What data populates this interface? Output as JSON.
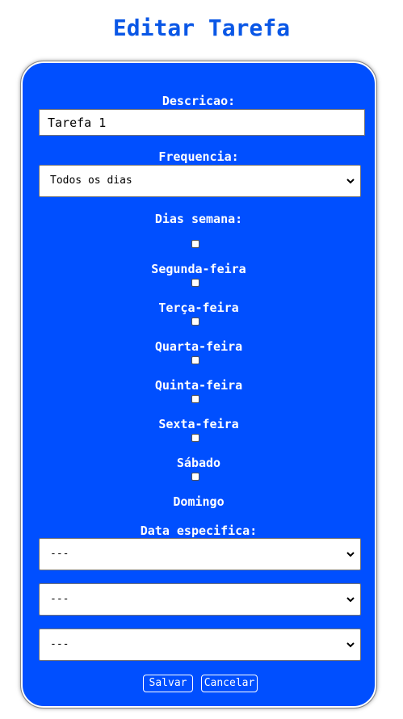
{
  "page": {
    "title": "Editar Tarefa"
  },
  "form": {
    "descricao_label": "Descricao:",
    "descricao_value": "Tarefa 1",
    "frequencia_label": "Frequencia:",
    "frequencia_value": "Todos os dias",
    "dias_semana_label": "Dias semana:",
    "dias": [
      {
        "label": "Segunda-feira",
        "checked": false
      },
      {
        "label": "Terça-feira",
        "checked": false
      },
      {
        "label": "Quarta-feira",
        "checked": false
      },
      {
        "label": "Quinta-feira",
        "checked": false
      },
      {
        "label": "Sexta-feira",
        "checked": false
      },
      {
        "label": "Sábado",
        "checked": false
      },
      {
        "label": "Domingo",
        "checked": false
      }
    ],
    "data_especifica_label": "Data especifica:",
    "data_selects": [
      "---",
      "---",
      "---"
    ]
  },
  "buttons": {
    "save_label": "Salvar",
    "cancel_label": "Cancelar"
  },
  "colors": {
    "title": "#0a57e6",
    "card_bg": "#004fff",
    "text": "#ffffff"
  }
}
